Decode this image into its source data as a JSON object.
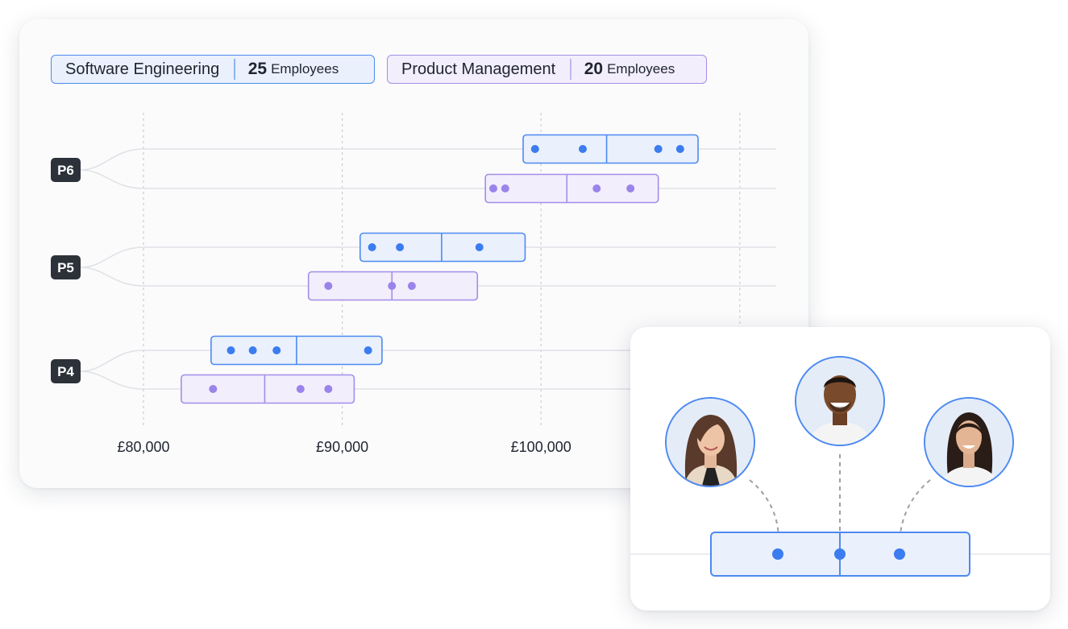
{
  "legend": {
    "software": {
      "name": "Software Engineering",
      "count": "25",
      "unit": "Employees"
    },
    "product": {
      "name": "Product Management",
      "count": "20",
      "unit": "Employees"
    }
  },
  "colors": {
    "software_fill": "#eaf1fc",
    "software_stroke": "#4d8af0",
    "software_dot": "#3b7cf0",
    "product_fill": "#f2eefc",
    "product_stroke": "#a48ee8",
    "product_dot": "#9a84ea",
    "level_badge": "#2c313a"
  },
  "chart_data": {
    "type": "box",
    "x_axis": {
      "ticks": [
        "£80,000",
        "£90,000",
        "£100,000"
      ],
      "tick_values": [
        80000,
        90000,
        100000,
        110000
      ],
      "gridlines": "dashed-vertical"
    },
    "levels": [
      {
        "label": "P6",
        "software": {
          "min": 99100,
          "median": 103300,
          "max": 107900,
          "points": [
            99700,
            102100,
            105900,
            107000
          ]
        },
        "product": {
          "min": 97200,
          "median": 101300,
          "max": 105900,
          "points": [
            97600,
            98200,
            102800,
            104500
          ]
        }
      },
      {
        "label": "P5",
        "software": {
          "min": 90900,
          "median": 95000,
          "max": 99200,
          "points": [
            91500,
            92900,
            96900
          ]
        },
        "product": {
          "min": 88300,
          "median": 92500,
          "max": 96800,
          "points": [
            89300,
            92500,
            93500
          ]
        }
      },
      {
        "label": "P4",
        "software": {
          "min": 83400,
          "median": 87700,
          "max": 92000,
          "points": [
            84400,
            85500,
            86700,
            91300
          ]
        },
        "product": {
          "min": 81900,
          "median": 86100,
          "max": 90600,
          "points": [
            83500,
            87900,
            89300
          ]
        }
      }
    ]
  },
  "detail": {
    "points": 3,
    "avatars": [
      "avatar-woman-brunette",
      "avatar-man-smiling",
      "avatar-woman-dark-hair"
    ]
  }
}
